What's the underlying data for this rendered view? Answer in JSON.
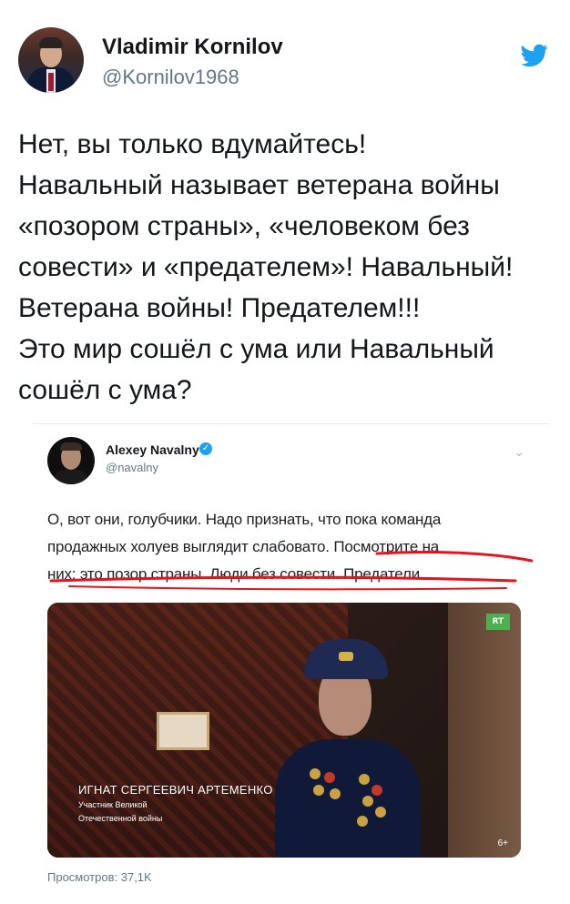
{
  "tweet": {
    "display_name": "Vladimir Kornilov",
    "handle": "@Kornilov1968",
    "lines": [
      "Нет, вы только вдумайтесь!",
      "Навальный называет ветерана войны",
      "«позором страны», «человеком без",
      "совести» и «предателем»! Навальный!",
      "Ветерана войны! Предателем!!!",
      "Это мир сошёл с ума или Навальный",
      "сошёл с ума?"
    ],
    "platform_icon": "twitter-bird-icon",
    "brand_color": "#1da1f2"
  },
  "embedded": {
    "display_name": "Alexey Navalny",
    "verified_icon": "verified-badge-icon",
    "handle": "@navalny",
    "menu_icon": "chevron-down-icon",
    "lines": [
      "О, вот они, голубчики. Надо признать, что пока команда",
      "продажных холуев выглядит слабовато. Посмотрите на",
      "них: это позор страны. Люди без совести. Предатели."
    ],
    "underline_color": "#e3141e",
    "video": {
      "channel_logo": "RT",
      "person_name": "ИГНАТ СЕРГЕЕВИЧ АРТЕМЕНКО",
      "person_title_1": "Участник Великой",
      "person_title_2": "Отечественной войны",
      "age_rating": "6+"
    },
    "views": "Просмотров: 37,1K"
  }
}
